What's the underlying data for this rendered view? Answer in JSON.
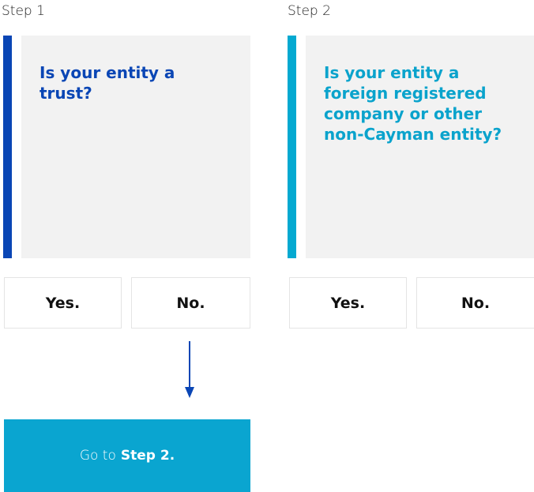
{
  "steps": [
    {
      "label": "Step 1",
      "question": "Is your entity a trust?",
      "yes_label": "Yes.",
      "no_label": "No.",
      "accent_color": "#0a46b5"
    },
    {
      "label": "Step 2",
      "question": "Is your entity a foreign registered company or other non-Cayman entity?",
      "yes_label": "Yes.",
      "no_label": "No.",
      "accent_color": "#04a9d1"
    }
  ],
  "goto": {
    "prefix": "Go to",
    "target": "Step 2."
  },
  "colors": {
    "card_background": "#f2f2f2",
    "goto_background": "#0aa5d0",
    "arrow": "#0a46b5"
  },
  "icons": {
    "flow_arrow": "arrow-down-icon"
  }
}
